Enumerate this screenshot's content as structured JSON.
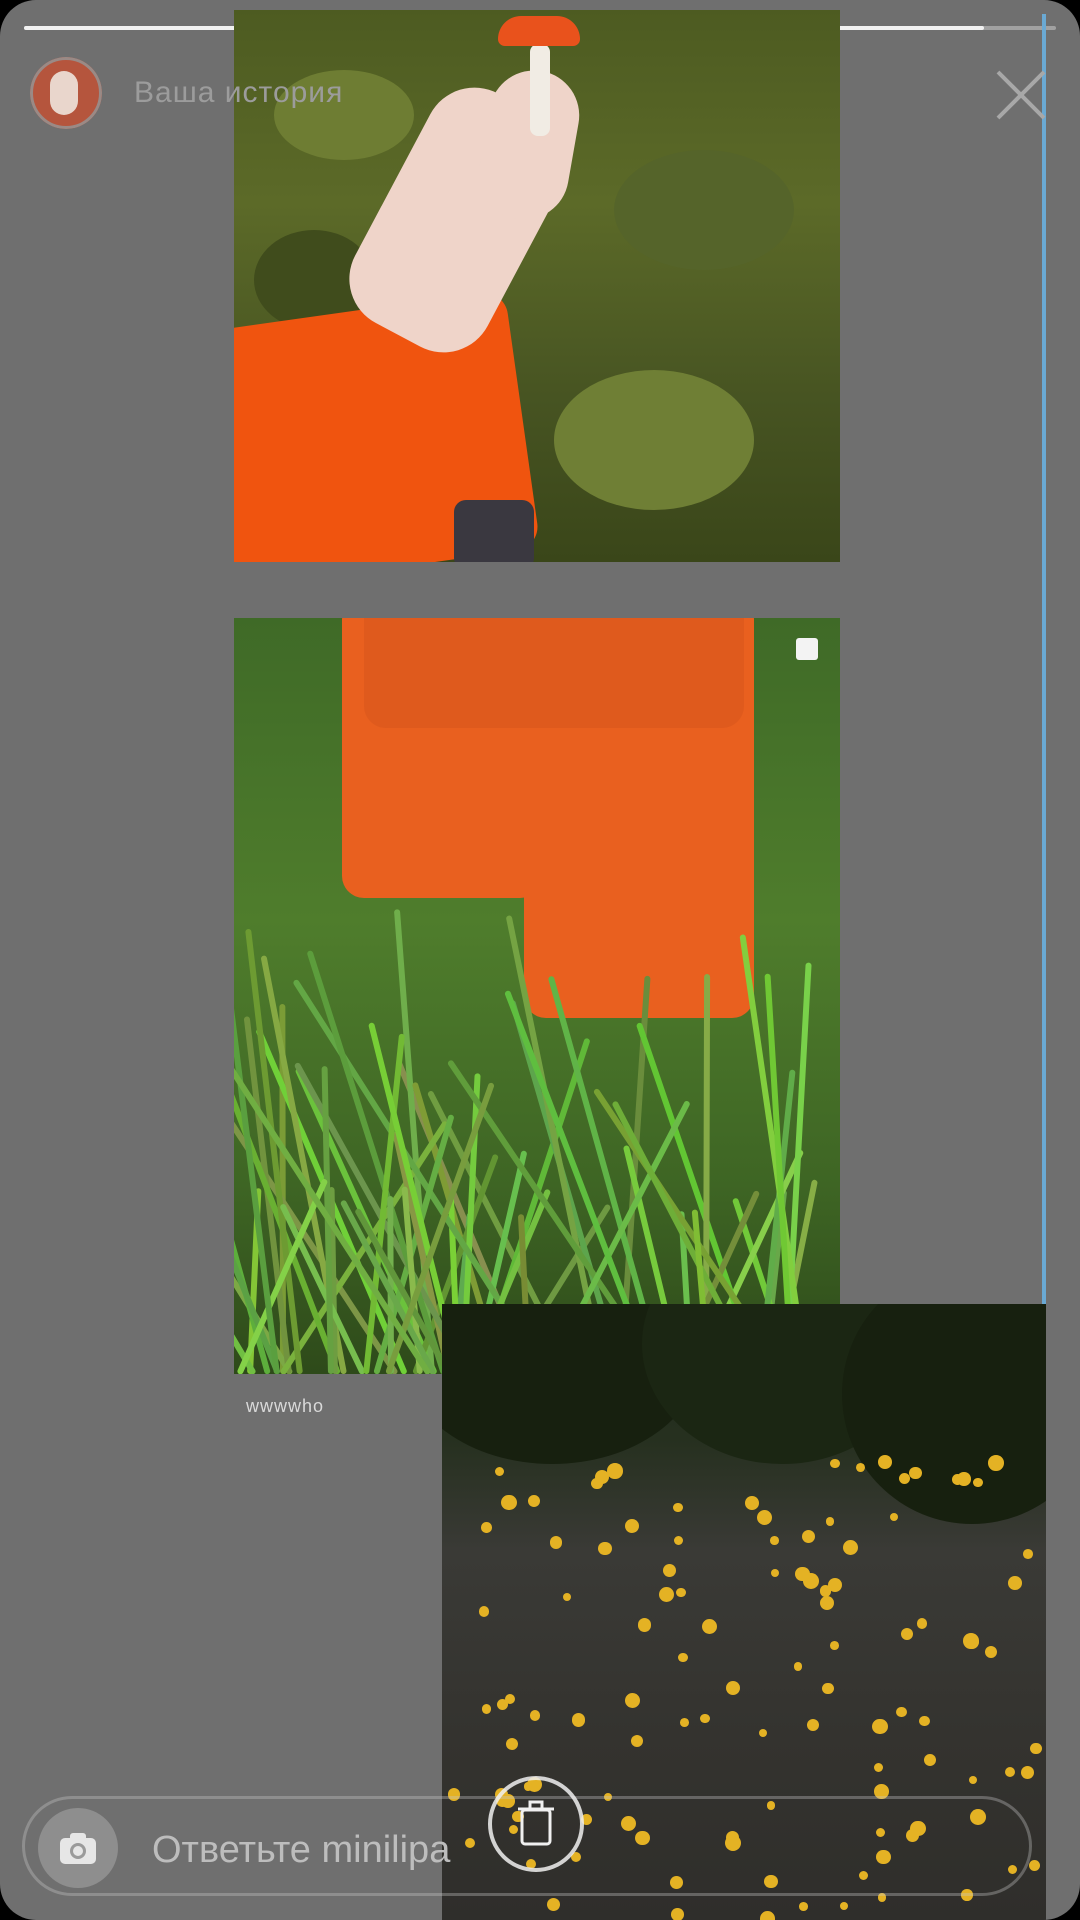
{
  "story": {
    "username": "Ваша история",
    "progress": 0.93
  },
  "caption": "wwwwho",
  "reply": {
    "placeholder": "Ответьте minilipa"
  },
  "icons": {
    "close": "close-icon",
    "camera": "camera-icon",
    "trash": "trash-icon"
  },
  "colors": {
    "background": "#6f6f6f",
    "accent_line": "#6aa9d3",
    "orange": "#f0540f",
    "petal_yellow": "#e4b224"
  }
}
